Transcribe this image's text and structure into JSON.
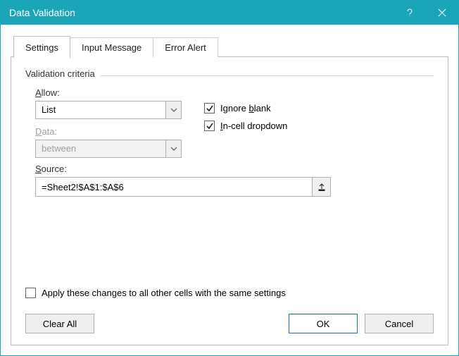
{
  "window": {
    "title": "Data Validation",
    "help_icon": "?",
    "close_icon": "×"
  },
  "tabs": {
    "settings": "Settings",
    "input_message": "Input Message",
    "error_alert": "Error Alert",
    "active": "settings"
  },
  "validation": {
    "header": "Validation criteria",
    "allow_label_pre": "A",
    "allow_label_post": "llow:",
    "allow_value": "List",
    "data_label_pre": "",
    "data_label_u": "D",
    "data_label_post": "ata:",
    "data_value": "between",
    "ignore_blank": {
      "checked": true,
      "label_pre": "Ignore ",
      "label_u": "b",
      "label_post": "lank"
    },
    "incell_dropdown": {
      "checked": true,
      "label_pre": "",
      "label_u": "I",
      "label_post": "n-cell dropdown"
    },
    "source_label_pre": "",
    "source_label_u": "S",
    "source_label_post": "ource:",
    "source_value": "=Sheet2!$A$1:$A$6"
  },
  "apply_all": {
    "checked": false,
    "label_pre": "Apply these changes to all other cells with the same settings",
    "label_u": "",
    "label_post": ""
  },
  "buttons": {
    "clear_all": "Clear All",
    "ok": "OK",
    "cancel": "Cancel"
  }
}
